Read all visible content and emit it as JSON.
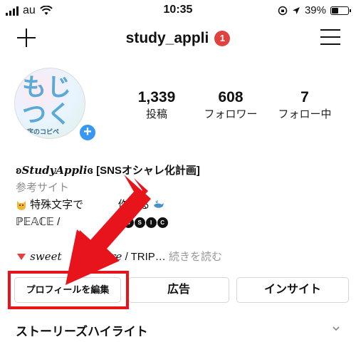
{
  "status_bar": {
    "carrier": "au",
    "time": "10:35",
    "battery": "39%",
    "battery_level": 0.39,
    "icons": [
      "signal-icon",
      "wifi-icon",
      "orientation-lock-icon",
      "location-icon",
      "battery-icon"
    ]
  },
  "header": {
    "username": "study_appli",
    "notification_count": "1",
    "icons": [
      "plus-icon",
      "hamburger-menu-icon"
    ]
  },
  "avatar": {
    "logo_text": "もじつく",
    "logo_subtext": "文字のコピペ",
    "add_icon": "+"
  },
  "stats": [
    {
      "value": "1,339",
      "label": "投稿"
    },
    {
      "value": "608",
      "label": "フォロワー"
    },
    {
      "value": "7",
      "label": "フォロー中"
    }
  ],
  "bio": {
    "name_prefix": "ʚ",
    "name_brand": "StudyAppli",
    "name_suffix": "ɞ [SNSオシャレ化計画]",
    "category": "参考サイト",
    "line1_text": "特殊文字で",
    "line1_text2": "作れる",
    "line2_text": "ℙ𝔼𝔸ℂ𝔼 /",
    "music_letters": [
      "M",
      "U",
      "S",
      "I",
      "C"
    ],
    "line3_text1": "sweet",
    "line3_text2": "picture",
    "line3_text3": "/ TRIP…",
    "more": "続きを読む"
  },
  "buttons": {
    "edit_profile": "プロフィールを編集",
    "ads": "広告",
    "insights": "インサイト"
  },
  "stories": {
    "title": "ストーリーズハイライト"
  },
  "colors": {
    "accent_red": "#e8141c",
    "badge_red": "#e0433f",
    "brand_blue": "#3897f0",
    "muted_gray": "#8e8e8e"
  }
}
